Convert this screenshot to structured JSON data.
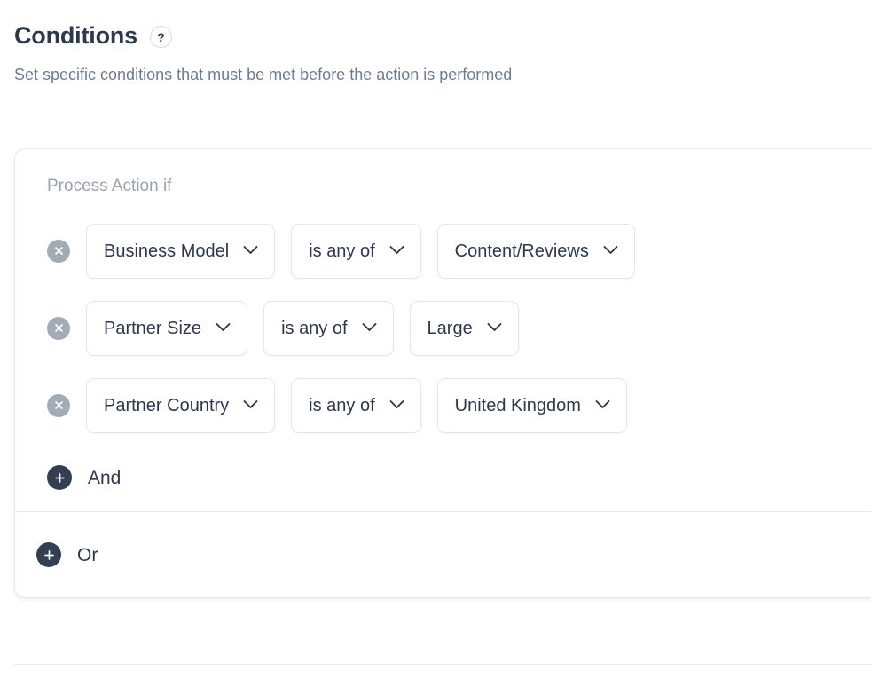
{
  "header": {
    "title": "Conditions",
    "help_icon_label": "?",
    "subtitle": "Set specific conditions that must be met before the action is performed"
  },
  "condition_group": {
    "label": "Process Action if",
    "remove_icon": "close-icon",
    "chevron_icon": "chevron-down-icon",
    "plus_icon": "plus-icon",
    "rows": [
      {
        "field": "Business Model",
        "operator": "is any of",
        "value": "Content/Reviews"
      },
      {
        "field": "Partner Size",
        "operator": "is any of",
        "value": "Large"
      },
      {
        "field": "Partner Country",
        "operator": "is any of",
        "value": "United Kingdom"
      }
    ],
    "add_and_label": "And",
    "add_or_label": "Or"
  },
  "colors": {
    "title": "#2e384d",
    "subtitle": "#707c8c",
    "group_label": "#9aa2ae",
    "remove_button": "#a3abb7",
    "plus_button": "#333f51",
    "card_border": "#e6e8eb",
    "pill_border": "#e3e6ea"
  }
}
